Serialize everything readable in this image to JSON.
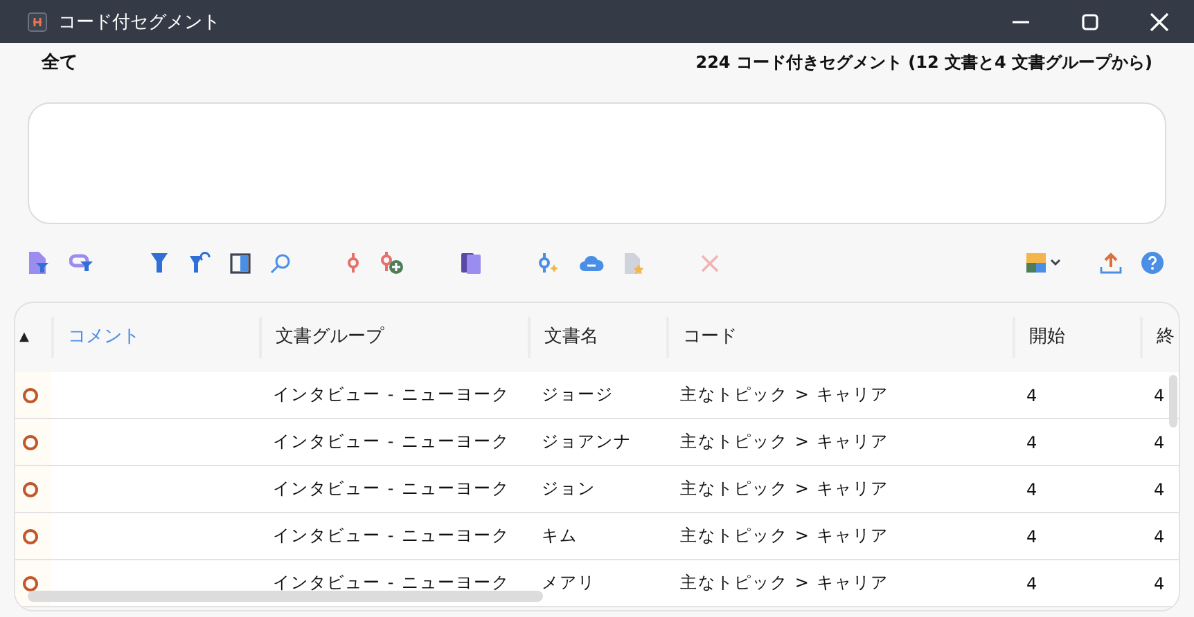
{
  "window": {
    "title": "コード付セグメント"
  },
  "filter_label": "全て",
  "summary": "224 コード付きセグメント (12 文書と4 文書グループから)",
  "toolbar": {
    "delete_enabled": false
  },
  "table": {
    "columns": [
      {
        "label": "▲",
        "selected": false
      },
      {
        "label": "コメント",
        "selected": true
      },
      {
        "label": "文書グループ",
        "selected": false
      },
      {
        "label": "文書名",
        "selected": false
      },
      {
        "label": "コード",
        "selected": false
      },
      {
        "label": "開始",
        "selected": false
      },
      {
        "label": "終",
        "selected": false
      }
    ],
    "rows": [
      {
        "group": "インタビュー - ニューヨーク",
        "document": "ジョージ",
        "code": "主なトピック > キャリア",
        "start": "4",
        "end": "4"
      },
      {
        "group": "インタビュー - ニューヨーク",
        "document": "ジョアンナ",
        "code": "主なトピック > キャリア",
        "start": "4",
        "end": "4"
      },
      {
        "group": "インタビュー - ニューヨーク",
        "document": "ジョン",
        "code": "主なトピック > キャリア",
        "start": "4",
        "end": "4"
      },
      {
        "group": "インタビュー - ニューヨーク",
        "document": "キム",
        "code": "主なトピック > キャリア",
        "start": "4",
        "end": "4"
      },
      {
        "group": "インタビュー - ニューヨーク",
        "document": "メアリ",
        "code": "主なトピック > キャリア",
        "start": "4",
        "end": "4"
      }
    ]
  }
}
